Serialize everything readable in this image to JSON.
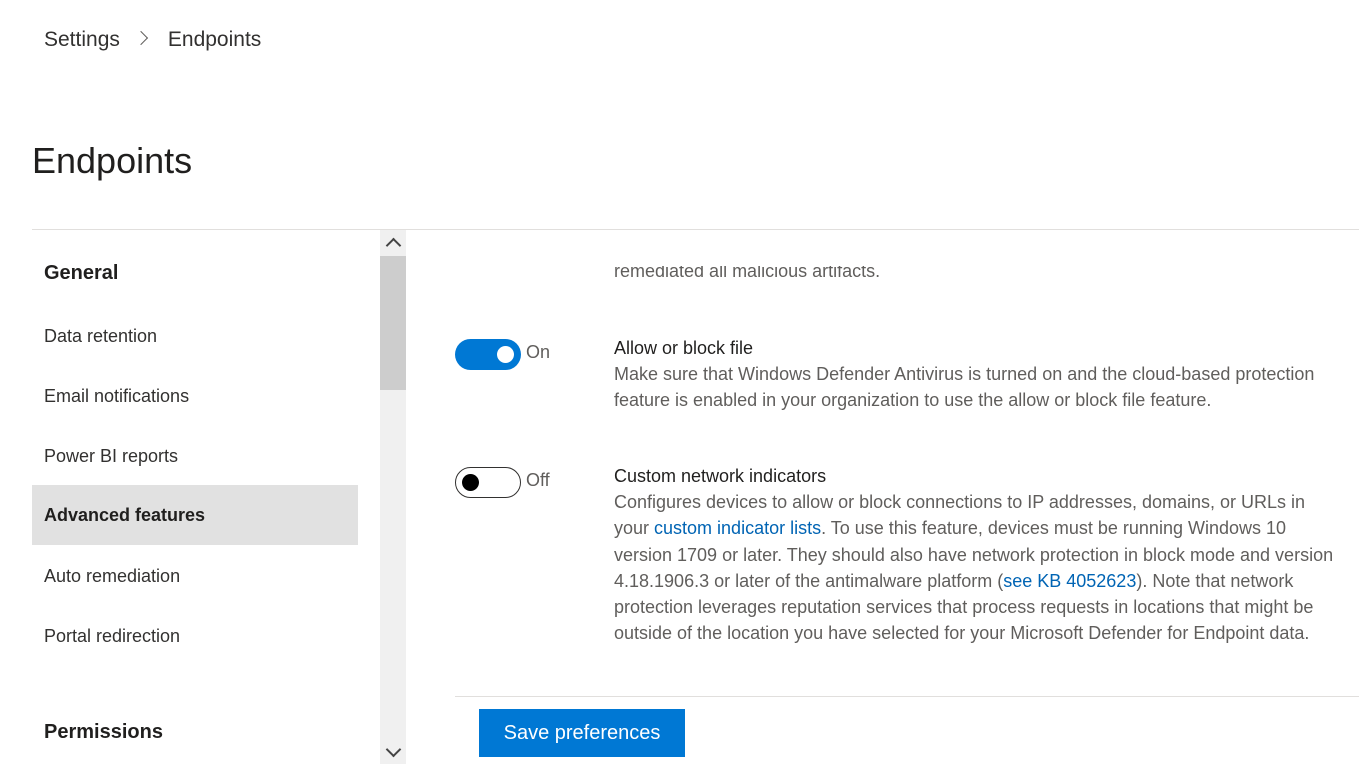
{
  "breadcrumb": {
    "items": [
      "Settings",
      "Endpoints"
    ]
  },
  "page": {
    "title": "Endpoints"
  },
  "sidebar": {
    "groups": [
      {
        "title": "General",
        "items": [
          {
            "label": "Data retention",
            "selected": false
          },
          {
            "label": "Email notifications",
            "selected": false
          },
          {
            "label": "Power BI reports",
            "selected": false
          },
          {
            "label": "Advanced features",
            "selected": true
          },
          {
            "label": "Auto remediation",
            "selected": false
          },
          {
            "label": "Portal redirection",
            "selected": false
          }
        ]
      },
      {
        "title": "Permissions",
        "items": []
      }
    ]
  },
  "content": {
    "cut_text": "remediated all malicious artifacts.",
    "features": [
      {
        "state": "On",
        "enabled": true,
        "title": "Allow or block file",
        "description": "Make sure that Windows Defender Antivirus is turned on and the cloud-based protection feature is enabled in your organization to use the allow or block file feature."
      },
      {
        "state": "Off",
        "enabled": false,
        "title": "Custom network indicators",
        "desc_part1": "Configures devices to allow or block connections to IP addresses, domains, or URLs in your ",
        "desc_link1": "custom indicator lists",
        "desc_part2": ". To use this feature, devices must be running Windows 10 version 1709 or later. They should also have network protection in block mode and version 4.18.1906.3 or later of the antimalware platform (",
        "desc_link2": "see KB 4052623",
        "desc_part3": "). Note that network protection leverages reputation services that process requests in locations that might be outside of the location you have selected for your Microsoft Defender for Endpoint data."
      }
    ]
  },
  "footer": {
    "save_label": "Save preferences"
  },
  "colors": {
    "accent": "#0078d4",
    "link": "#0064b4",
    "selected_bg": "#e1e1e1"
  }
}
